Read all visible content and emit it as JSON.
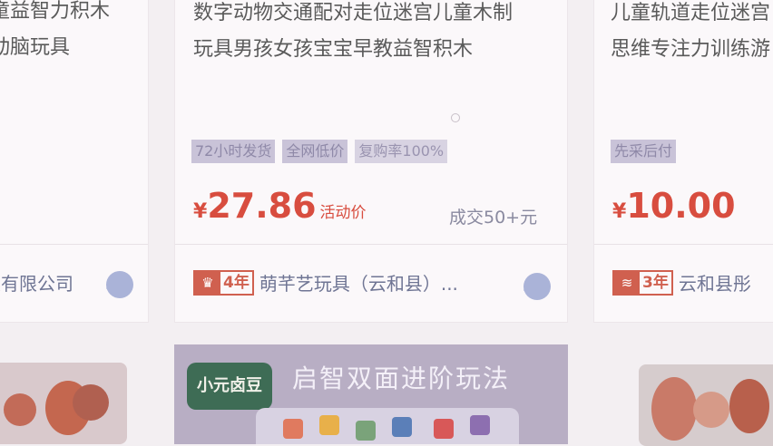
{
  "cards": [
    {
      "title_lines": [
        "童益智力积木",
        "动脑玩具"
      ],
      "shop_name": "具有限公司"
    },
    {
      "title_lines": [
        "数字动物交通配对走位迷宫儿童木制",
        "玩具男孩女孩宝宝早教益智积木"
      ],
      "tags": [
        "72小时发货",
        "全网低价",
        "复购率100%"
      ],
      "price_symbol": "¥",
      "price": "27.86",
      "price_note": "活动价",
      "deal": "成交50+元",
      "badge_icon": "crown-icon",
      "badge_years": "4年",
      "shop_name": "萌芊艺玩具（云和县）..."
    },
    {
      "title_lines": [
        "儿童轨道走位迷宫",
        "思维专注力训练游"
      ],
      "tags": [
        "先采后付"
      ],
      "price_symbol": "¥",
      "price": "10.00",
      "badge_icon": "flow-icon",
      "badge_years": "3年",
      "shop_name": "云和县彤"
    }
  ],
  "banner": {
    "logo_text": "小元卤豆",
    "slogan": "启智双面进阶玩法"
  },
  "colors": {
    "price_red": "#d84d3f",
    "tag_bg": "#c9c3d8",
    "card_bg": "#fbf8fa"
  }
}
